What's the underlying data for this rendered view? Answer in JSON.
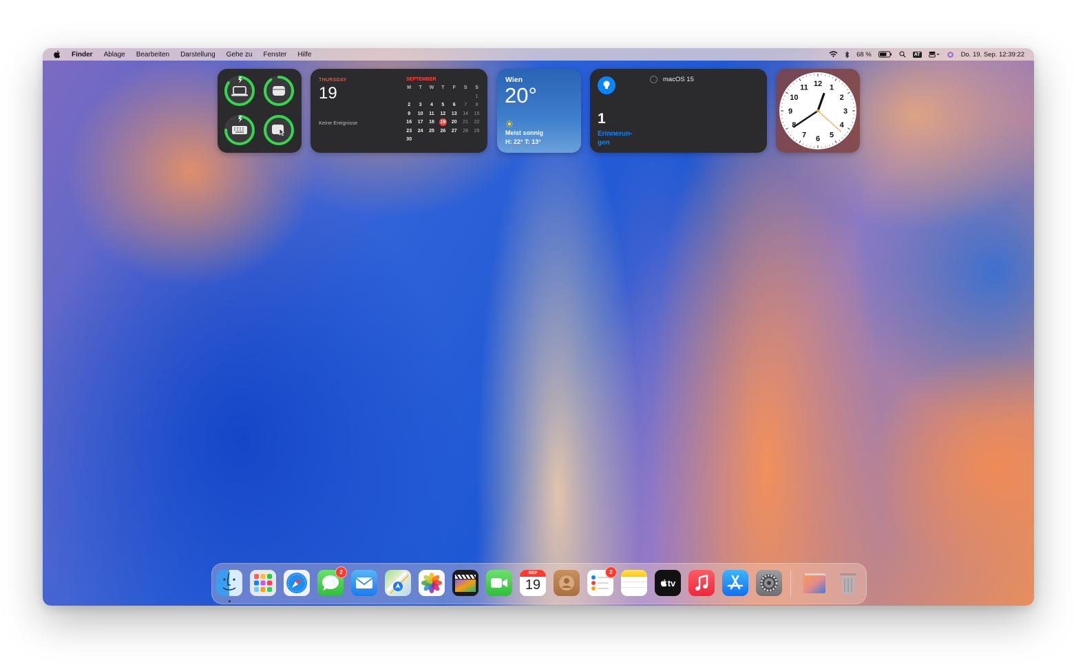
{
  "menubar": {
    "app": "Finder",
    "menus": [
      "Ablage",
      "Bearbeiten",
      "Darstellung",
      "Gehe zu",
      "Fenster",
      "Hilfe"
    ],
    "battery_percent": "68 %",
    "input_source": "AT",
    "datetime": "Do. 19. Sep.  12:39:22"
  },
  "widgets": {
    "batteries": {
      "items": [
        {
          "icon": "laptop-icon",
          "level": 0.85,
          "charging": true
        },
        {
          "icon": "airpods-case-icon",
          "level": 0.9,
          "charging": false
        },
        {
          "icon": "keyboard-icon",
          "level": 0.75,
          "charging": true
        },
        {
          "icon": "mouse-icon",
          "level": 1.0,
          "charging": false
        }
      ],
      "ring_color": "#32d74b"
    },
    "calendar": {
      "weekday": "THURSDAY",
      "day": "19",
      "no_events": "Keine Ereignisse",
      "month": "SEPTEMBER",
      "headers": [
        "M",
        "T",
        "W",
        "T",
        "F",
        "S",
        "S"
      ],
      "weeks": [
        [
          "",
          "",
          "",
          "",
          "",
          "",
          "1"
        ],
        [
          "2",
          "3",
          "4",
          "5",
          "6",
          "7",
          "8"
        ],
        [
          "9",
          "10",
          "11",
          "12",
          "13",
          "14",
          "15"
        ],
        [
          "16",
          "17",
          "18",
          "19",
          "20",
          "21",
          "22"
        ],
        [
          "23",
          "24",
          "25",
          "26",
          "27",
          "28",
          "29"
        ],
        [
          "30",
          "",
          "",
          "",
          "",
          "",
          ""
        ]
      ],
      "today": "19",
      "accent": "#ff453a"
    },
    "weather": {
      "city": "Wien",
      "temp": "20°",
      "condition": "Meist sonnig",
      "range": "H: 22° T: 13°"
    },
    "reminders": {
      "count": "1",
      "label": "Erinnerun-gen",
      "list_item": "macOS 15",
      "accent": "#0a84ff"
    },
    "clock": {
      "numbers": [
        "12",
        "1",
        "2",
        "3",
        "4",
        "5",
        "6",
        "7",
        "8",
        "9",
        "10",
        "11"
      ],
      "time": {
        "h": 12,
        "m": 39,
        "s": 22
      }
    }
  },
  "dock": {
    "apps": [
      {
        "name": "Finder",
        "icon": "finder-icon",
        "running": true
      },
      {
        "name": "Launchpad",
        "icon": "launchpad-icon"
      },
      {
        "name": "Safari",
        "icon": "safari-icon"
      },
      {
        "name": "Nachrichten",
        "icon": "messages-icon",
        "badge": "2"
      },
      {
        "name": "Mail",
        "icon": "mail-icon"
      },
      {
        "name": "Karten",
        "icon": "maps-icon"
      },
      {
        "name": "Fotos",
        "icon": "photos-icon"
      },
      {
        "name": "Final Cut Pro",
        "icon": "final-cut-icon"
      },
      {
        "name": "FaceTime",
        "icon": "facetime-icon"
      },
      {
        "name": "Kalender",
        "icon": "calendar-icon",
        "month": "SEP",
        "day": "19"
      },
      {
        "name": "Kontakte",
        "icon": "contacts-icon"
      },
      {
        "name": "Erinnerungen",
        "icon": "reminders-icon",
        "badge": "2"
      },
      {
        "name": "Notizen",
        "icon": "notes-icon"
      },
      {
        "name": "TV",
        "icon": "tv-icon",
        "label": "tv"
      },
      {
        "name": "Musik",
        "icon": "music-icon"
      },
      {
        "name": "App Store",
        "icon": "appstore-icon"
      },
      {
        "name": "Systemeinstellungen",
        "icon": "settings-icon"
      }
    ],
    "extras": [
      {
        "name": "Downloads",
        "icon": "downloads-stack-icon"
      },
      {
        "name": "Papierkorb",
        "icon": "trash-icon"
      }
    ]
  }
}
